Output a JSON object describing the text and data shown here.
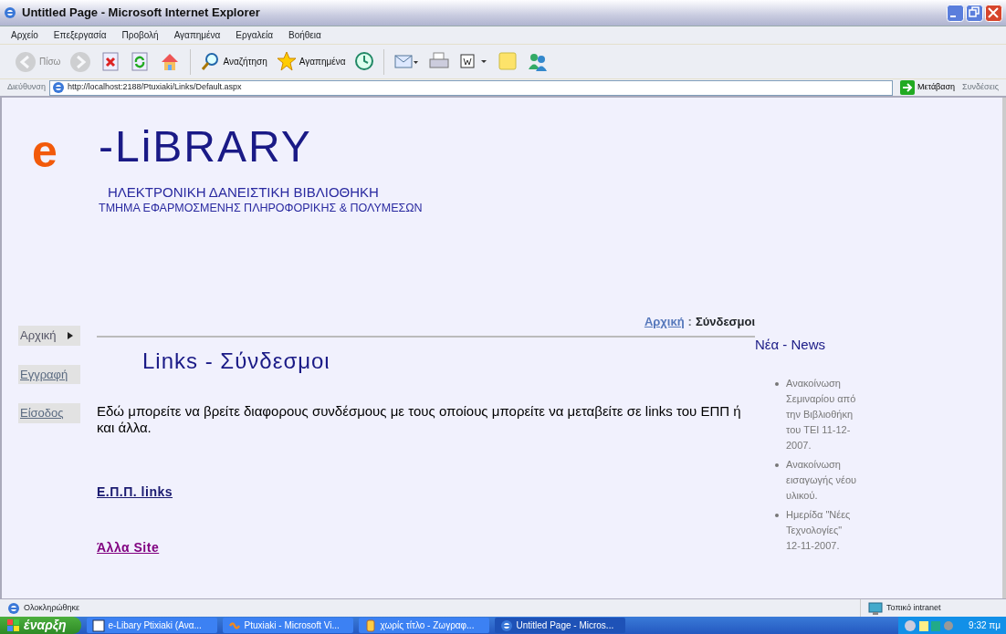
{
  "window": {
    "title": "Untitled Page - Microsoft Internet Explorer"
  },
  "menu_bar": [
    "Αρχείο",
    "Επεξεργασία",
    "Προβολή",
    "Αγαπημένα",
    "Εργαλεία",
    "Βοήθεια"
  ],
  "toolbar": [
    {
      "kind": "back",
      "label": "Πίσω",
      "disabled": true
    },
    {
      "kind": "forward",
      "disabled": true
    },
    {
      "kind": "stop"
    },
    {
      "kind": "refresh"
    },
    {
      "kind": "home"
    },
    {
      "kind": "search",
      "label": "Αναζήτηση"
    },
    {
      "kind": "favorites",
      "label": "Αγαπημένα"
    },
    {
      "kind": "history"
    },
    {
      "kind": "mail"
    },
    {
      "kind": "print"
    },
    {
      "kind": "edit"
    },
    {
      "kind": "note"
    },
    {
      "kind": "messenger"
    }
  ],
  "address_bar": {
    "label": "Διεύθυνση",
    "url": "http://localhost:2188/Ptuxiaki/Links/Default.aspx",
    "go": "Μετάβαση",
    "links": "Συνδέσεις"
  },
  "page": {
    "logo": {
      "letter": "e",
      "name": "-LiBRARY",
      "subtitle": "ΗΛΕΚΤΡΟΝΙΚΗ ΔΑΝΕΙΣΤΙΚΗ ΒΙΒΛΙΟΘΗΚΗ",
      "department": "ΤΜΗΜΑ ΕΦΑΡΜΟΣΜΕΝΗΣ ΠΛΗΡΟΦΟΡΙΚΗΣ & ΠΟΛΥΜΕΣΩΝ"
    },
    "side_menu": [
      {
        "label": "Αρχική",
        "submenu": true
      },
      {
        "label": "Εγγραφή",
        "submenu": false
      },
      {
        "label": "Είσοδος",
        "submenu": false
      }
    ],
    "breadcrumb": {
      "link": "Αρχική",
      "separator": ":",
      "current": "Σύνδεσμοι"
    },
    "heading": "Links - Σύνδεσμοι",
    "intro": "Εδώ μπορείτε να βρείτε διαφορους συνδέσμους με τους οποίους μπορείτε να μεταβείτε σε links του ΕΠΠ ή και άλλα.",
    "links": [
      {
        "label": "Ε.Π.Π. links",
        "visited": false
      },
      {
        "label": "Άλλα Site",
        "visited": true
      }
    ],
    "news": {
      "title": "Νέα - News",
      "items": [
        "Ανακοίνωση Σεμιναρίου από την Βιβλιοθήκη του ΤΕΙ 11-12-2007.",
        "Ανακοίνωση εισαγωγής νέου υλικού.",
        "Ημερίδα \"Νέες Τεχνολογίες\" 12-11-2007."
      ]
    }
  },
  "status_bar": {
    "text": "Ολοκληρώθηκε",
    "zone": "Τοπικό intranet"
  },
  "taskbar": {
    "start": "έναρξη",
    "tasks": [
      {
        "kind": "word",
        "label": "e-Libary Ptixiaki (Ανα...",
        "selected": false
      },
      {
        "kind": "studio",
        "label": "Ptuxiaki - Microsoft Vi...",
        "selected": false
      },
      {
        "kind": "paint",
        "label": "χωρίς τίτλο - Ζωγραφ...",
        "selected": false
      },
      {
        "kind": "ie",
        "label": "Untitled Page - Micros...",
        "selected": true
      }
    ],
    "clock": "9:32 πμ"
  }
}
